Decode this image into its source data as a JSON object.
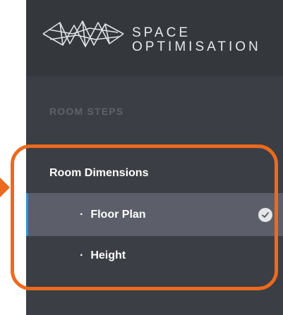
{
  "brand": {
    "line1": "SPACE",
    "line2": "OPTIMISATION",
    "logo_icon": "wireframe-logo-icon"
  },
  "sidebar": {
    "section_header": "ROOM STEPS",
    "items": [
      {
        "label": "Room Dimensions",
        "type": "parent",
        "active": false
      },
      {
        "label": "Floor Plan",
        "type": "child",
        "active": true,
        "completed": true,
        "icon": "check-circle-icon"
      },
      {
        "label": "Height",
        "type": "child",
        "active": false
      }
    ]
  },
  "annotation": {
    "color": "#ec6a1d"
  },
  "colors": {
    "sidebar_bg": "#3b3e44",
    "active_item_bg": "#5c5f69",
    "active_indicator": "#2b8fd6",
    "muted_text": "#5f6369"
  }
}
